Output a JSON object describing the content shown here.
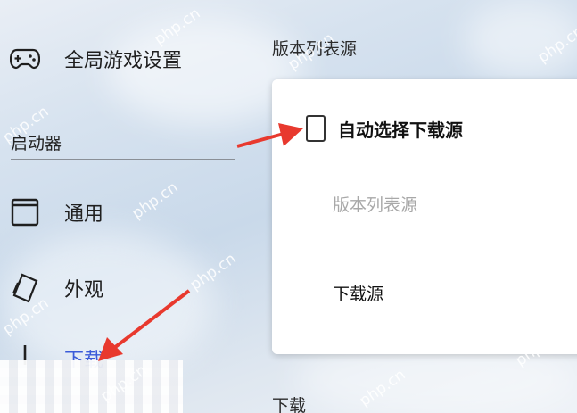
{
  "sidebar": {
    "global_settings": {
      "label": "全局游戏设置",
      "icon": "gamepad-icon"
    },
    "section_title": "启动器",
    "general": {
      "label": "通用",
      "icon": "window-icon"
    },
    "appearance": {
      "label": "外观",
      "icon": "brush-icon"
    },
    "download": {
      "label": "下载",
      "icon": "download-icon"
    }
  },
  "main": {
    "heading_version_source": "版本列表源",
    "card": {
      "auto_select_label": "自动选择下载源",
      "auto_select_checked": false,
      "version_list_source_label": "版本列表源",
      "download_source_label": "下载源"
    },
    "heading_download": "下载"
  },
  "watermark": "php.cn",
  "colors": {
    "arrow": "#e8392e",
    "selected": "#3a5bd9",
    "disabled_text": "#a8a8a8"
  }
}
